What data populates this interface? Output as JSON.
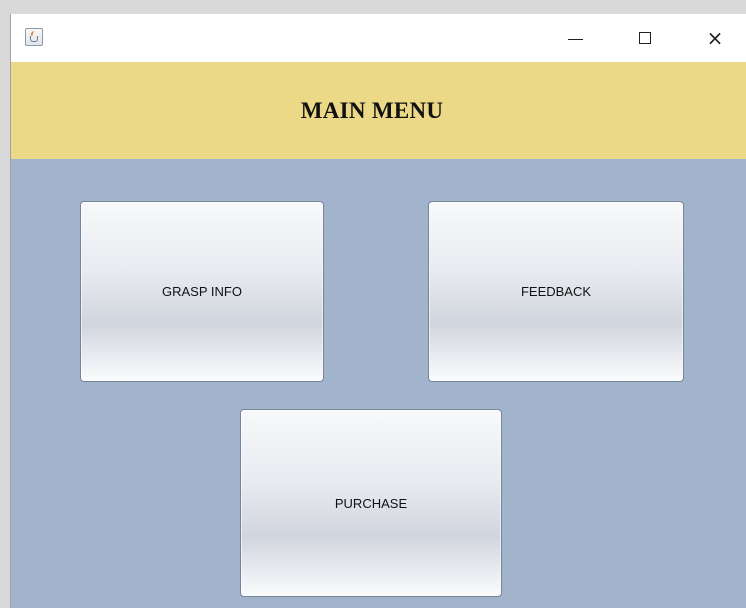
{
  "window": {
    "title": ""
  },
  "icons": {
    "app": "java-cup-icon",
    "minimize": "minimize-icon",
    "maximize": "maximize-icon",
    "close": "close-icon"
  },
  "header": {
    "title": "MAIN MENU"
  },
  "buttons": {
    "grasp_info": "GRASP INFO",
    "feedback": "FEEDBACK",
    "purchase": "PURCHASE"
  },
  "colors": {
    "header_background": "#ecd988",
    "content_background": "#a2b3cc",
    "button_border": "#74849a"
  }
}
